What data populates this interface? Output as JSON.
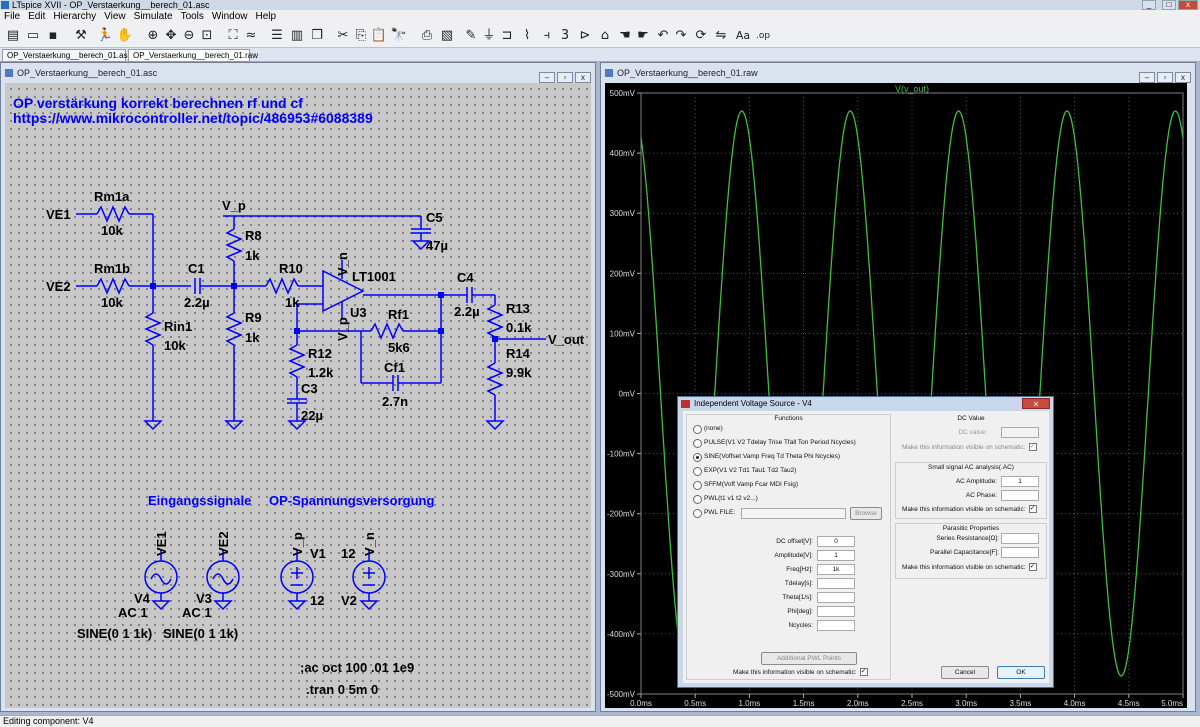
{
  "app": {
    "title": "LTspice XVII - OP_Verstaerkung__berech_01.asc"
  },
  "menu": [
    "File",
    "Edit",
    "Hierarchy",
    "View",
    "Simulate",
    "Tools",
    "Window",
    "Help"
  ],
  "tabs": [
    {
      "label": "OP_Verstaerkung__berech_01.asc"
    },
    {
      "label": "OP_Verstaerkung__berech_01.raw"
    }
  ],
  "schematic_window": {
    "title": "OP_Verstaerkung__berech_01.asc"
  },
  "plot_window": {
    "title": "OP_Verstaerkung__berech_01.raw"
  },
  "schematic": {
    "heading_line1": "OP verstärkung korrekt berechnen rf und cf",
    "heading_line2": "https://www.mikrocontroller.net/topic/486953#6088389",
    "labels": {
      "ve1": "VE1",
      "ve2": "VE2",
      "vp_net": "V_p",
      "vn_net": "V_n",
      "vout_net": "V_out",
      "rm1a": "Rm1a",
      "rm1a_val": "10k",
      "rm1b": "Rm1b",
      "rm1b_val": "10k",
      "c1": "C1",
      "c1_val": "2.2µ",
      "rin1": "Rin1",
      "rin1_val": "10k",
      "r8": "R8",
      "r8_val": "1k",
      "r9": "R9",
      "r9_val": "1k",
      "r10": "R10",
      "r10_val": "1k",
      "c5": "C5",
      "c5_val": "47µ",
      "opamp": "LT1001",
      "u3": "U3",
      "vp_pin": "V_p",
      "vn_pin": "V_n",
      "rf1": "Rf1",
      "rf1_val": "5k6",
      "cf1": "Cf1",
      "cf1_val": "2.7n",
      "r12": "R12",
      "r12_val": "1.2k",
      "c3": "C3",
      "c3_val": "22µ",
      "c4": "C4",
      "c4_val": "2.2µ",
      "r13": "R13",
      "r13_val": "0.1k",
      "r14": "R14",
      "r14_val": "9.9k"
    },
    "section_inputs": "Eingangssignale",
    "section_supply": "OP-Spannungsversorgung",
    "sources": {
      "v4_net": "VE1",
      "v4_name": "V4",
      "v4_ac": "AC 1",
      "v4_sine": "SINE(0 1 1k)",
      "v3_net": "VE2",
      "v3_name": "V3",
      "v3_ac": "AC 1",
      "v3_sine": "SINE(0 1 1k)",
      "v1_net": "V_p",
      "v1_name": "V1",
      "v1_val": "12",
      "v2_net": "V_n",
      "v2_name": "V2",
      "v2_val": "12"
    },
    "directive_ac": ";ac oct 100 .01 1e9",
    "directive_tran": ".tran 0 5m 0"
  },
  "chart_data": {
    "type": "line",
    "title": "V(v_out)",
    "series": [
      {
        "name": "V(v_out)",
        "color": "#3fbf3f",
        "amplitude_mV": 470,
        "frequency_kHz": 1,
        "phase_shift_ms": 0.18
      }
    ],
    "xlim": [
      0,
      5
    ],
    "ylim": [
      -500,
      500
    ],
    "x_ticks": [
      "0.0ms",
      "0.5ms",
      "1.0ms",
      "1.5ms",
      "2.0ms",
      "2.5ms",
      "3.0ms",
      "3.5ms",
      "4.0ms",
      "4.5ms",
      "5.0ms"
    ],
    "y_ticks": [
      "500mV",
      "400mV",
      "300mV",
      "200mV",
      "100mV",
      "0mV",
      "-100mV",
      "-200mV",
      "-300mV",
      "-400mV",
      "-500mV"
    ],
    "grid": true,
    "background": "#000000"
  },
  "dialog": {
    "title": "Independent Voltage Source - V4",
    "functions_title": "Functions",
    "functions": [
      {
        "label": "(none)",
        "selected": false
      },
      {
        "label": "PULSE(V1 V2 Tdelay Trise Tfall Ton Period Ncycles)",
        "selected": false
      },
      {
        "label": "SINE(Voffset Vamp Freq Td Theta Phi Ncycles)",
        "selected": true
      },
      {
        "label": "EXP(V1 V2 Td1 Tau1 Td2 Tau2)",
        "selected": false
      },
      {
        "label": "SFFM(Voff Vamp Fcar MDI Fsig)",
        "selected": false
      },
      {
        "label": "PWL(t1 v1 t2 v2...)",
        "selected": false
      },
      {
        "label": "PWL FILE:",
        "selected": false
      }
    ],
    "browse": "Browse",
    "sine_fields": [
      {
        "label": "DC offset[V]:",
        "value": "0"
      },
      {
        "label": "Amplitude[V]:",
        "value": "1"
      },
      {
        "label": "Freq[Hz]:",
        "value": "1k"
      },
      {
        "label": "Tdelay[s]:",
        "value": ""
      },
      {
        "label": "Theta[1/s]:",
        "value": ""
      },
      {
        "label": "Phi[deg]:",
        "value": ""
      },
      {
        "label": "Ncycles:",
        "value": ""
      }
    ],
    "additional_pwl": "Additional PWL Points",
    "visible_functions": "Make this information visible on schematic:",
    "dc_title": "DC Value",
    "dc_label": "DC value:",
    "dc_visible": "Make this information visible on schematic:",
    "ac_title": "Small signal AC analysis(.AC)",
    "ac_amp_label": "AC Amplitude:",
    "ac_amp_value": "1",
    "ac_phase_label": "AC Phase:",
    "ac_visible": "Make this information visible on schematic:",
    "para_title": "Parasitic Properties",
    "series_res": "Series Resistance[Ω]:",
    "par_cap": "Parallel Capacitance[F]:",
    "para_visible": "Make this information visible on schematic:",
    "cancel": "Cancel",
    "ok": "OK",
    "close": "✕"
  },
  "status": {
    "text": "Editing component: V4"
  }
}
